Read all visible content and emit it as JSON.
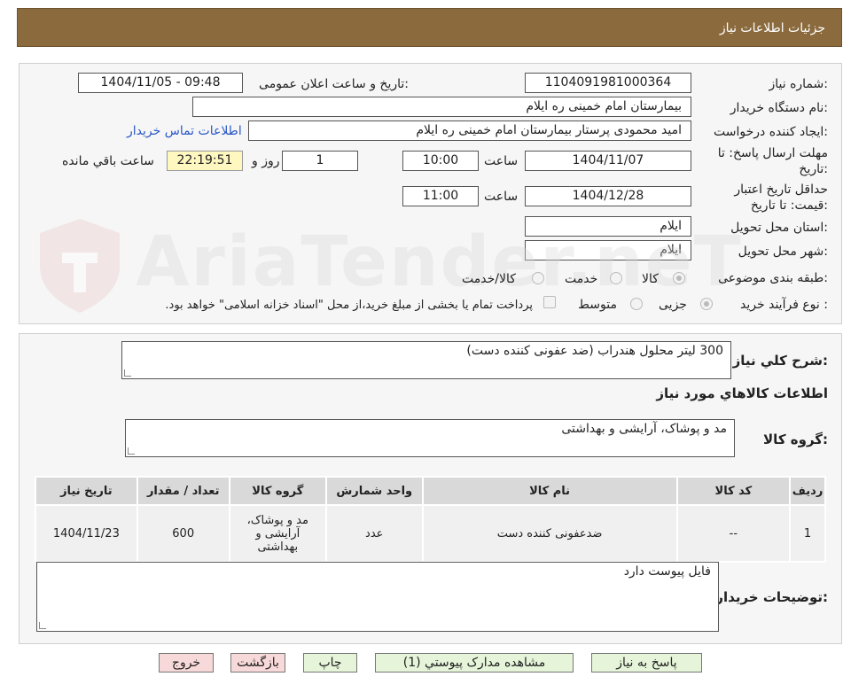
{
  "header": {
    "title": "جزئیات اطلاعات نیاز"
  },
  "form": {
    "need_number_label": "شماره نیاز:",
    "need_number": "1104091981000364",
    "announce_label": "تاریخ و ساعت اعلان عمومی:",
    "announce_value": "1404/11/05 - 09:48",
    "buyer_org_label": "نام دستگاه خریدار:",
    "buyer_org": "بیمارستان امام خمینی  ره  ایلام",
    "creator_label": "ایجاد کننده درخواست:",
    "creator": "امید محمودی پرستار بیمارستان امام خمینی  ره  ایلام",
    "contact_link": "اطلاعات تماس خریدار",
    "deadline_label_1": "مهلت ارسال پاسخ: تا",
    "deadline_label_2": "تاریخ:",
    "deadline_date": "1404/11/07",
    "time_label": "ساعت",
    "deadline_time": "10:00",
    "days_value": "1",
    "days_label": "روز و",
    "remaining_time": "22:19:51",
    "remaining_label": "ساعت باقي مانده",
    "validity_label_1": "حداقل تاریخ اعتبار",
    "validity_label_2": "قیمت: تا تاریخ:",
    "validity_date": "1404/12/28",
    "validity_time": "11:00",
    "province_label": "استان محل تحویل:",
    "province": "ایلام",
    "city_label": "شهر محل تحویل:",
    "city": "ایلام",
    "category_label": "طبقه بندی موضوعی:",
    "category_options": [
      "کالا",
      "خدمت",
      "کالا/خدمت"
    ],
    "process_label": "نوع فرآیند خرید :",
    "process_options": [
      "جزیی",
      "متوسط"
    ],
    "payment_note": "پرداخت تمام یا بخشی از مبلغ خرید،از محل \"اسناد خزانه اسلامی\" خواهد بود."
  },
  "summary": {
    "desc_label": "شرح کلي نياز:",
    "desc_value": "300 لیتر محلول هندراب (ضد عفونی کننده دست)",
    "goods_title": "اطلاعات کالاهاي مورد نياز",
    "group_label": "گروه کالا:",
    "group_value": "مد و پوشاک، آرایشی و بهداشتی",
    "table": {
      "headers": [
        "رديف",
        "کد کالا",
        "نام کالا",
        "واحد شمارش",
        "گروه کالا",
        "تعداد / مقدار",
        "تاریخ نیاز"
      ],
      "rows": [
        [
          "1",
          "--",
          "ضدعفونی کننده دست",
          "عدد",
          "مد و پوشاک، آرایشی و بهداشتی",
          "600",
          "1404/11/23"
        ]
      ]
    },
    "buyer_notes_label": "توضیحات خریدار:",
    "buyer_notes_value": "فایل پیوست دارد"
  },
  "buttons": {
    "reply": "پاسخ به نياز",
    "attachments": "مشاهده مدارک پیوستي (1)",
    "print": "چاپ",
    "back": "بازگشت",
    "exit": "خروج"
  },
  "watermark": {
    "text": "AriaTender.neT"
  },
  "colors": {
    "header_bg": "#8b6b3e",
    "link": "#2a57c7",
    "button_green": "#e6f5da",
    "button_pink": "#f8d9d9"
  }
}
